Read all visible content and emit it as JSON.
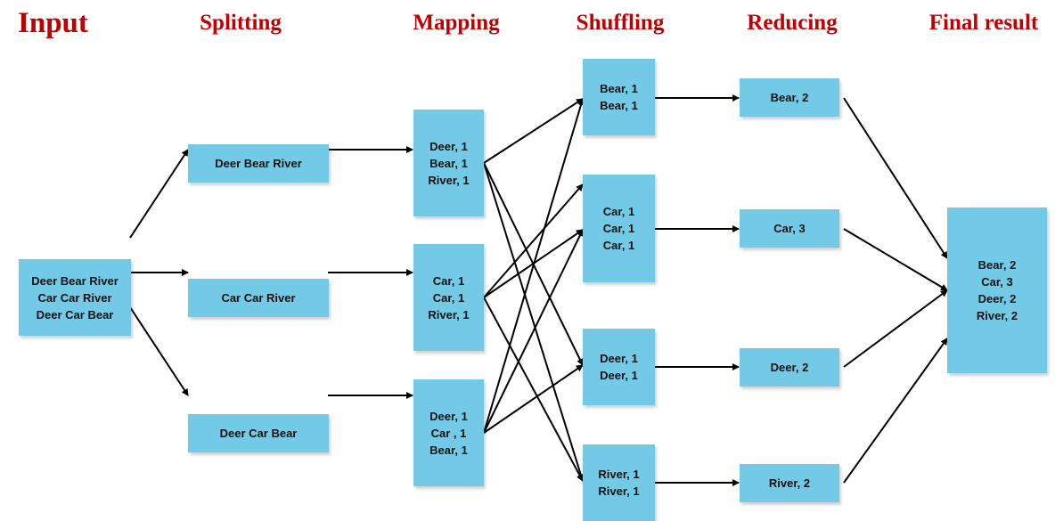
{
  "headers": {
    "input": "Input",
    "splitting": "Splitting",
    "mapping": "Mapping",
    "shuffling": "Shuffling",
    "reducing": "Reducing",
    "final": "Final result"
  },
  "input": {
    "lines": [
      "Deer Bear River",
      "Car Car River",
      "Deer Car Bear"
    ]
  },
  "splitting": [
    {
      "text": "Deer Bear River"
    },
    {
      "text": "Car Car River"
    },
    {
      "text": "Deer Car Bear"
    }
  ],
  "mapping": [
    {
      "lines": [
        "Deer, 1",
        "Bear, 1",
        "River, 1"
      ]
    },
    {
      "lines": [
        "Car, 1",
        "Car, 1",
        "River, 1"
      ]
    },
    {
      "lines": [
        "Deer, 1",
        "Car , 1",
        "Bear, 1"
      ]
    }
  ],
  "shuffling": [
    {
      "lines": [
        "Bear, 1",
        "Bear, 1"
      ]
    },
    {
      "lines": [
        "Car, 1",
        "Car, 1",
        "Car, 1"
      ]
    },
    {
      "lines": [
        "Deer, 1",
        "Deer, 1"
      ]
    },
    {
      "lines": [
        "River, 1",
        "River, 1"
      ]
    }
  ],
  "reducing": [
    {
      "text": "Bear, 2"
    },
    {
      "text": "Car, 3"
    },
    {
      "text": "Deer, 2"
    },
    {
      "text": "River, 2"
    }
  ],
  "final": {
    "lines": [
      "Bear, 2",
      "Car, 3",
      "Deer, 2",
      "River, 2"
    ]
  },
  "colors": {
    "box": "#73cae6",
    "header": "#c00000",
    "arrow": "#000000"
  }
}
